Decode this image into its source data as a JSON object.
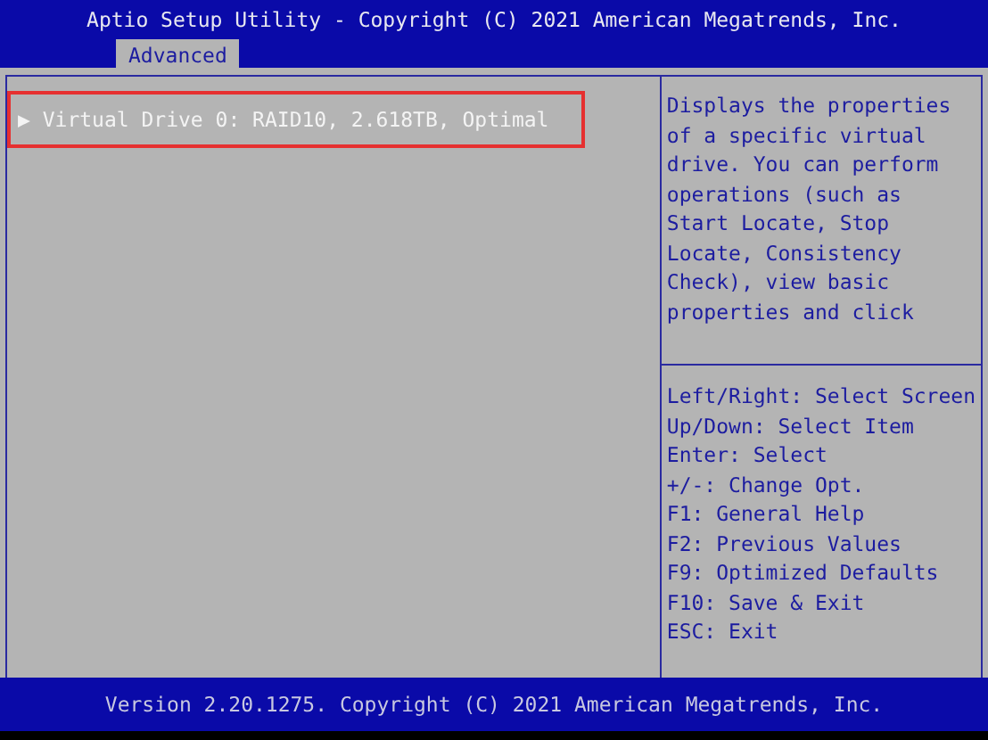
{
  "header": {
    "title": "Aptio Setup Utility - Copyright (C) 2021 American Megatrends, Inc.",
    "tabs": [
      {
        "label": "Advanced",
        "selected": true
      }
    ]
  },
  "items": [
    {
      "arrow": "▶",
      "label": "Virtual Drive 0: RAID10, 2.618TB, Optimal",
      "selected": true,
      "outlined": true
    }
  ],
  "help": {
    "text": "Displays the properties of a specific virtual drive. You can perform operations (such as Start Locate, Stop Locate, Consistency Check), view basic properties and click",
    "keys": [
      "Left/Right: Select Screen",
      "Up/Down: Select Item",
      "Enter: Select",
      "+/-: Change Opt.",
      "F1: General Help",
      "F2: Previous Values",
      "F9: Optimized Defaults",
      "F10: Save & Exit",
      "ESC: Exit"
    ]
  },
  "footer": {
    "text": "Version 2.20.1275. Copyright (C) 2021 American Megatrends, Inc."
  }
}
